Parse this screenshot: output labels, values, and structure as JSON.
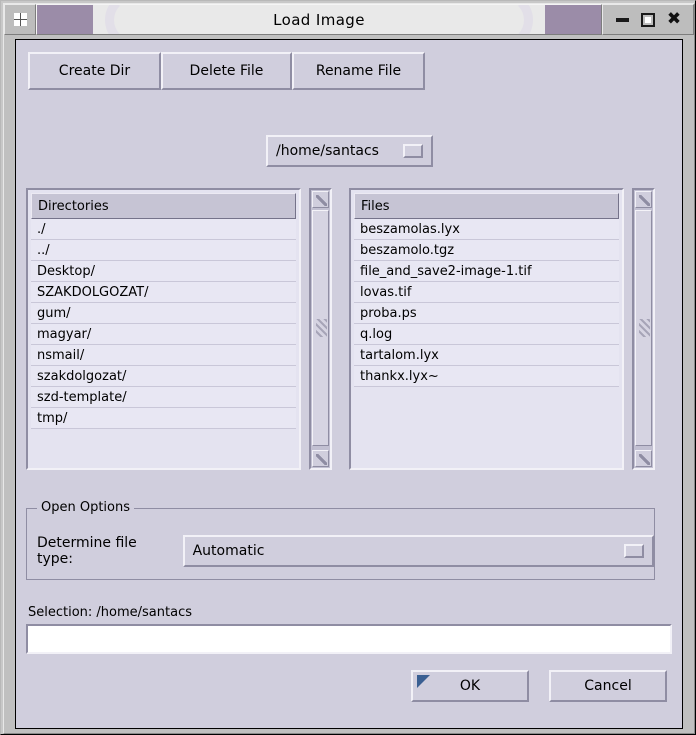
{
  "window": {
    "title": "Load Image",
    "sysmenu_icon": "grid-icon",
    "controls": {
      "minimize": "minimize-icon",
      "maximize": "maximize-icon",
      "close": "close-icon",
      "close_glyph": "✖"
    }
  },
  "toolbar": {
    "create_dir": "Create Dir",
    "delete_file": "Delete File",
    "rename_file": "Rename File"
  },
  "path_menu": {
    "value": "/home/santacs",
    "indicator": "option-menu-indicator"
  },
  "directories": {
    "header": "Directories",
    "items": [
      "./",
      "../",
      "Desktop/",
      "SZAKDOLGOZAT/",
      "gum/",
      "magyar/",
      "nsmail/",
      "szakdolgozat/",
      "szd-template/",
      "tmp/"
    ]
  },
  "files": {
    "header": "Files",
    "items": [
      "beszamolas.lyx",
      "beszamolo.tgz",
      "file_and_save2-image-1.tif",
      "lovas.tif",
      "proba.ps",
      "q.log",
      "tartalom.lyx",
      "thankx.lyx~"
    ]
  },
  "open_options": {
    "legend": "Open Options",
    "file_type_label": "Determine file type:",
    "file_type_value": "Automatic"
  },
  "selection": {
    "label": "Selection: /home/santacs",
    "value": "",
    "placeholder": ""
  },
  "actions": {
    "ok": "OK",
    "cancel": "Cancel"
  },
  "colors": {
    "dialog_bg": "#d0cedd",
    "titlebar_accent": "#9b8ca8",
    "titlebar_bg": "#e9e9e9",
    "list_bg": "#e8e7f3",
    "list_header_bg": "#c6c4d4",
    "shadow": "#8f8da3",
    "highlight": "#f2f1f7",
    "default_button_indicator": "#3a5f92",
    "input_bg": "#ffffff"
  }
}
